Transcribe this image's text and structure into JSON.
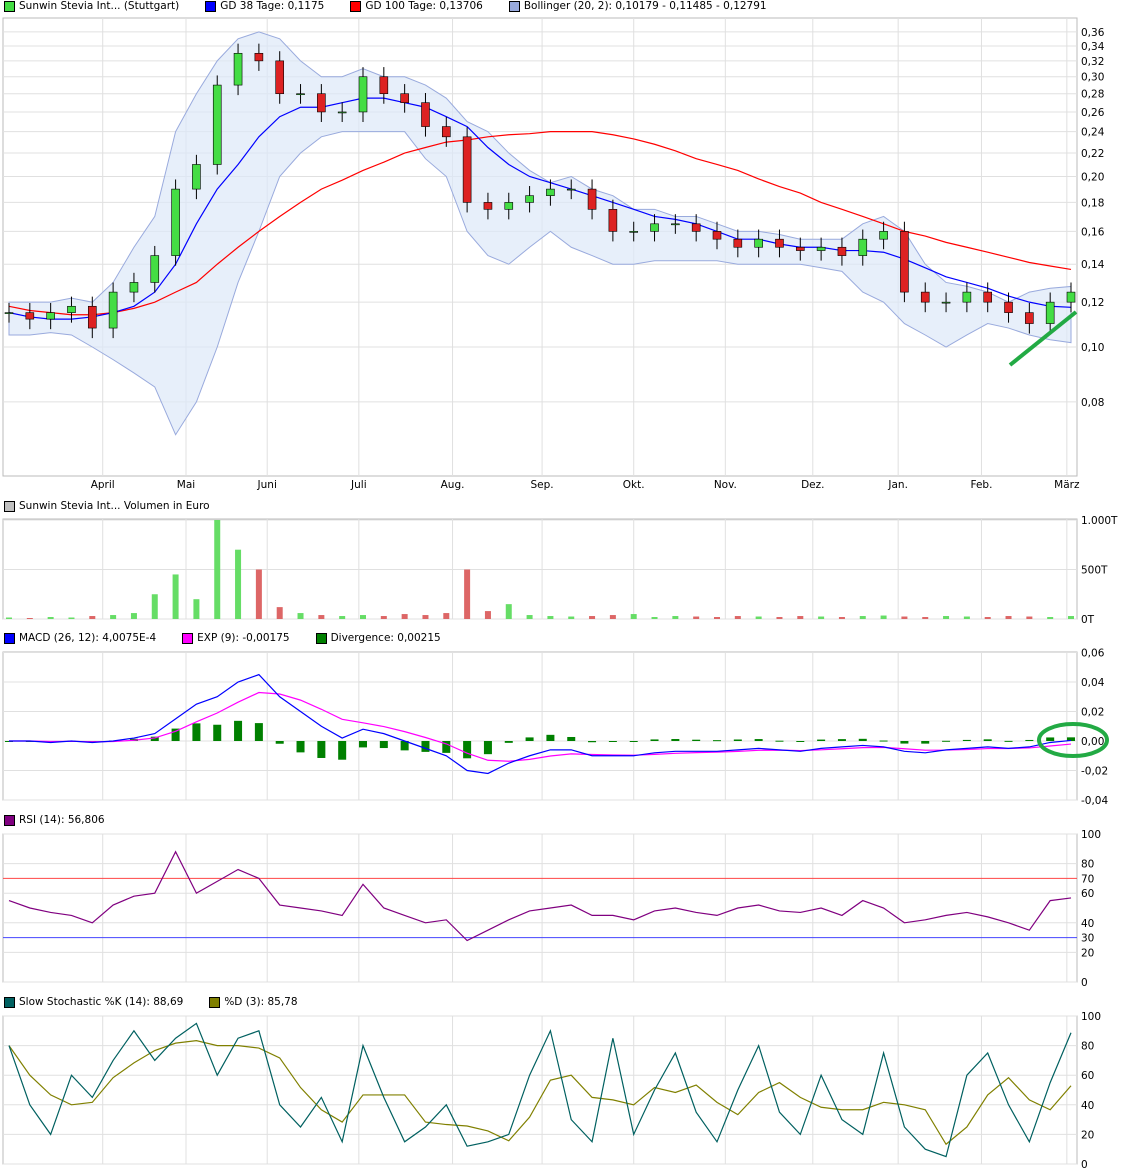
{
  "legends": {
    "price": [
      {
        "label": "Sunwin Stevia Int... (Stuttgart)",
        "color": "#44dd44"
      },
      {
        "label": "GD 38 Tage: 0,1175",
        "color": "#0000ff"
      },
      {
        "label": "GD 100 Tage: 0,13706",
        "color": "#ff0000"
      },
      {
        "label": "Bollinger (20, 2): 0,10179 - 0,11485 - 0,12791",
        "color": "#99aadd"
      }
    ],
    "volume": [
      {
        "label": "Sunwin Stevia Int... Volumen in Euro",
        "color": "#c0c0c0"
      }
    ],
    "macd": [
      {
        "label": "MACD (26, 12): 4,0075E-4",
        "color": "#0000ff"
      },
      {
        "label": "EXP (9): -0,00175",
        "color": "#ff00ff"
      },
      {
        "label": "Divergence: 0,00215",
        "color": "#008000"
      }
    ],
    "rsi": [
      {
        "label": "RSI (14): 56,806",
        "color": "#800080"
      }
    ],
    "stoch": [
      {
        "label": "Slow Stochastic %K (14): 88,69",
        "color": "#006060"
      },
      {
        "label": "%D (3): 85,78",
        "color": "#808000"
      }
    ]
  },
  "chart_data": [
    {
      "type": "candlestick",
      "title": "Sunwin Stevia Int... (Stuttgart)",
      "scale": "log",
      "ylim": [
        0.065,
        0.37
      ],
      "y_ticks": [
        "0,08",
        "0,10",
        "0,12",
        "0,14",
        "0,16",
        "0,18",
        "0,20",
        "0,22",
        "0,24",
        "0,26",
        "0,28",
        "0,30",
        "0,32",
        "0,34",
        "0,36"
      ],
      "x_months": [
        {
          "label": "April",
          "week": 4.5
        },
        {
          "label": "Mai",
          "week": 8.5
        },
        {
          "label": "Juni",
          "week": 12.4
        },
        {
          "label": "Juli",
          "week": 16.8
        },
        {
          "label": "Aug.",
          "week": 21.3
        },
        {
          "label": "Sep.",
          "week": 25.6
        },
        {
          "label": "Okt.",
          "week": 30
        },
        {
          "label": "Nov.",
          "week": 34.4
        },
        {
          "label": "Dez.",
          "week": 38.6
        },
        {
          "label": "Jan.",
          "week": 42.7
        },
        {
          "label": "Feb.",
          "week": 46.7
        },
        {
          "label": "März",
          "week": 50.8
        }
      ],
      "close": [
        0.115,
        0.112,
        0.115,
        0.118,
        0.108,
        0.125,
        0.13,
        0.145,
        0.19,
        0.21,
        0.29,
        0.33,
        0.32,
        0.28,
        0.28,
        0.26,
        0.26,
        0.3,
        0.28,
        0.27,
        0.245,
        0.235,
        0.18,
        0.175,
        0.18,
        0.185,
        0.19,
        0.19,
        0.175,
        0.16,
        0.16,
        0.165,
        0.165,
        0.16,
        0.155,
        0.15,
        0.155,
        0.15,
        0.148,
        0.15,
        0.145,
        0.155,
        0.16,
        0.125,
        0.12,
        0.12,
        0.125,
        0.12,
        0.115,
        0.11,
        0.12,
        0.125
      ],
      "gd38": [
        0.115,
        0.113,
        0.112,
        0.112,
        0.113,
        0.115,
        0.118,
        0.125,
        0.14,
        0.165,
        0.19,
        0.21,
        0.235,
        0.255,
        0.265,
        0.265,
        0.27,
        0.275,
        0.275,
        0.27,
        0.265,
        0.255,
        0.245,
        0.225,
        0.21,
        0.2,
        0.195,
        0.19,
        0.185,
        0.18,
        0.175,
        0.17,
        0.168,
        0.165,
        0.16,
        0.155,
        0.155,
        0.152,
        0.15,
        0.15,
        0.148,
        0.148,
        0.147,
        0.143,
        0.138,
        0.133,
        0.13,
        0.127,
        0.123,
        0.12,
        0.118,
        0.1175
      ],
      "gd100": [
        0.118,
        0.116,
        0.115,
        0.114,
        0.114,
        0.115,
        0.117,
        0.12,
        0.125,
        0.13,
        0.14,
        0.15,
        0.16,
        0.17,
        0.18,
        0.19,
        0.197,
        0.205,
        0.212,
        0.22,
        0.225,
        0.23,
        0.232,
        0.235,
        0.237,
        0.238,
        0.24,
        0.24,
        0.24,
        0.237,
        0.233,
        0.228,
        0.222,
        0.215,
        0.21,
        0.205,
        0.198,
        0.192,
        0.187,
        0.18,
        0.175,
        0.17,
        0.165,
        0.16,
        0.157,
        0.153,
        0.15,
        0.147,
        0.144,
        0.141,
        0.139,
        0.13706
      ],
      "boll_upper": [
        0.12,
        0.12,
        0.12,
        0.122,
        0.12,
        0.13,
        0.15,
        0.17,
        0.24,
        0.28,
        0.32,
        0.35,
        0.36,
        0.35,
        0.32,
        0.3,
        0.3,
        0.31,
        0.3,
        0.3,
        0.29,
        0.275,
        0.25,
        0.24,
        0.22,
        0.205,
        0.195,
        0.2,
        0.19,
        0.185,
        0.175,
        0.175,
        0.17,
        0.17,
        0.165,
        0.16,
        0.16,
        0.158,
        0.155,
        0.155,
        0.155,
        0.165,
        0.17,
        0.16,
        0.14,
        0.13,
        0.128,
        0.125,
        0.12,
        0.125,
        0.127,
        0.12791
      ],
      "boll_lower": [
        0.105,
        0.105,
        0.106,
        0.105,
        0.1,
        0.095,
        0.09,
        0.085,
        0.07,
        0.08,
        0.1,
        0.13,
        0.16,
        0.2,
        0.22,
        0.235,
        0.24,
        0.24,
        0.24,
        0.24,
        0.215,
        0.2,
        0.16,
        0.145,
        0.14,
        0.15,
        0.16,
        0.15,
        0.145,
        0.14,
        0.14,
        0.142,
        0.142,
        0.142,
        0.142,
        0.14,
        0.14,
        0.14,
        0.14,
        0.138,
        0.136,
        0.125,
        0.12,
        0.11,
        0.105,
        0.1,
        0.105,
        0.11,
        0.108,
        0.105,
        0.103,
        0.10179
      ]
    },
    {
      "type": "bar",
      "title": "Volumen in Euro",
      "ylim": [
        0,
        1000
      ],
      "y_ticks": [
        "0T",
        "500T",
        "1.000T"
      ],
      "values": [
        15,
        10,
        20,
        15,
        30,
        40,
        60,
        250,
        450,
        200,
        1000,
        700,
        500,
        120,
        60,
        40,
        30,
        40,
        30,
        50,
        40,
        60,
        500,
        80,
        150,
        40,
        30,
        25,
        30,
        40,
        50,
        20,
        30,
        25,
        20,
        30,
        25,
        20,
        30,
        25,
        20,
        30,
        35,
        25,
        20,
        30,
        25,
        20,
        30,
        25,
        20,
        30
      ]
    },
    {
      "type": "line",
      "title": "MACD",
      "ylim": [
        -0.04,
        0.06
      ],
      "y_ticks": [
        "-0,04",
        "-0,02",
        "0,00",
        "0,02",
        "0,04",
        "0,06"
      ],
      "macd": [
        0,
        0,
        -0.001,
        0,
        -0.001,
        0,
        0.002,
        0.005,
        0.015,
        0.025,
        0.03,
        0.04,
        0.045,
        0.03,
        0.02,
        0.01,
        0.002,
        0.008,
        0.005,
        0,
        -0.005,
        -0.01,
        -0.02,
        -0.022,
        -0.015,
        -0.01,
        -0.006,
        -0.006,
        -0.01,
        -0.01,
        -0.01,
        -0.008,
        -0.007,
        -0.007,
        -0.007,
        -0.006,
        -0.005,
        -0.006,
        -0.007,
        -0.005,
        -0.004,
        -0.003,
        -0.004,
        -0.007,
        -0.008,
        -0.006,
        -0.005,
        -0.004,
        -0.005,
        -0.004,
        -0.001,
        0.0004
      ]
    },
    {
      "type": "line",
      "title": "RSI (14)",
      "ylim": [
        0,
        100
      ],
      "y_ticks": [
        "0",
        "20",
        "40",
        "60",
        "80",
        "100"
      ],
      "levels": [
        "30",
        "70"
      ],
      "values": [
        55,
        50,
        47,
        45,
        40,
        52,
        58,
        60,
        88,
        60,
        68,
        76,
        70,
        52,
        50,
        48,
        45,
        66,
        50,
        45,
        40,
        42,
        28,
        35,
        42,
        48,
        50,
        52,
        45,
        45,
        42,
        48,
        50,
        47,
        45,
        50,
        52,
        48,
        47,
        50,
        45,
        55,
        50,
        40,
        42,
        45,
        47,
        44,
        40,
        35,
        55,
        56.8
      ]
    },
    {
      "type": "line",
      "title": "Slow Stochastic",
      "ylim": [
        0,
        100
      ],
      "y_ticks": [
        "0",
        "20",
        "40",
        "60",
        "80",
        "100"
      ],
      "k": [
        80,
        40,
        20,
        60,
        45,
        70,
        90,
        70,
        85,
        95,
        60,
        85,
        90,
        40,
        25,
        45,
        15,
        80,
        45,
        15,
        25,
        40,
        12,
        15,
        20,
        60,
        90,
        30,
        15,
        85,
        20,
        50,
        75,
        35,
        15,
        50,
        80,
        35,
        20,
        60,
        30,
        20,
        75,
        25,
        10,
        5,
        60,
        75,
        40,
        15,
        55,
        88.7
      ]
    }
  ]
}
